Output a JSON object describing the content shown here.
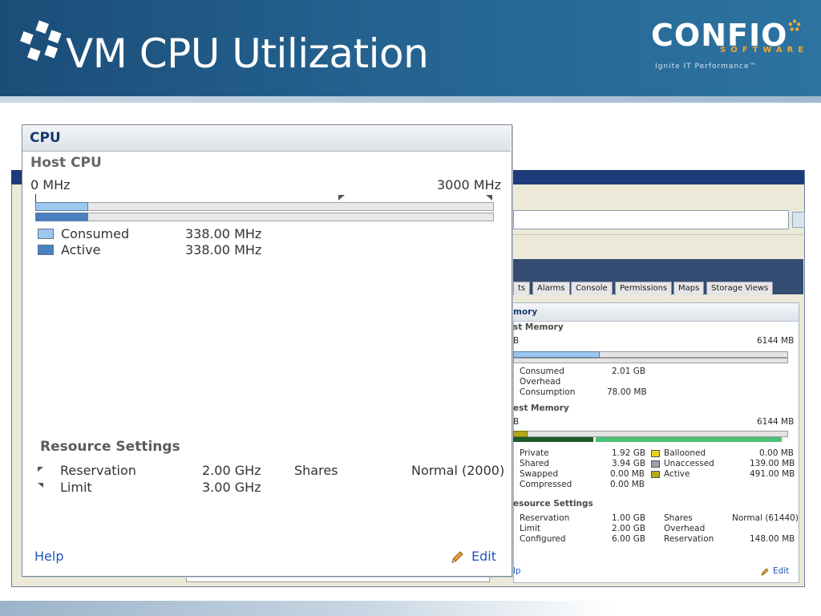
{
  "slide": {
    "title": "VM CPU Utilization",
    "logo_text": "CONFIO",
    "logo_sub": "SOFTWARE",
    "logo_tagline": "Ignite IT Performance™",
    "colors": {
      "header": "#1b4d78",
      "accent": "#f0a830"
    }
  },
  "cpu_panel": {
    "title": "CPU",
    "host_cpu": {
      "heading": "Host CPU",
      "scale_min": "0 MHz",
      "scale_max": "3000 MHz",
      "consumed_fraction": 0.113,
      "active_fraction": 0.113,
      "legend": [
        {
          "label": "Consumed",
          "value": "338.00 MHz",
          "color": "#9cc8ef"
        },
        {
          "label": "Active",
          "value": "338.00 MHz",
          "color": "#4a7fc0"
        }
      ]
    },
    "resource_settings": {
      "heading": "Resource Settings",
      "rows": [
        {
          "label": "Reservation",
          "value": "2.00 GHz"
        },
        {
          "label": "Limit",
          "value": "3.00 GHz"
        }
      ],
      "shares_label": "Shares",
      "shares_value": "Normal (2000)"
    },
    "help": "Help",
    "edit": "Edit"
  },
  "background_client": {
    "tabs": [
      "ts",
      "Alarms",
      "Console",
      "Permissions",
      "Maps",
      "Storage Views"
    ],
    "panel_title": "mory",
    "host_memory": {
      "heading": "st Memory",
      "scale_min": "B",
      "scale_max": "6144 MB",
      "rows": [
        {
          "label": "Consumed",
          "value": "2.01 GB"
        },
        {
          "label": "Overhead",
          "value": ""
        },
        {
          "label": "Consumption",
          "value": "78.00 MB"
        }
      ]
    },
    "guest_memory": {
      "heading": "est Memory",
      "scale_min": "B",
      "scale_max": "6144 MB",
      "left_rows": [
        {
          "label": "Private",
          "value": "1.92 GB"
        },
        {
          "label": "Shared",
          "value": "3.94 GB"
        },
        {
          "label": "Swapped",
          "value": "0.00 MB"
        },
        {
          "label": "Compressed",
          "value": "0.00 MB"
        }
      ],
      "right_rows": [
        {
          "label": "Ballooned",
          "value": "0.00 MB",
          "color": "#f2d01a"
        },
        {
          "label": "Unaccessed",
          "value": "139.00 MB",
          "color": "#a0a0a0"
        },
        {
          "label": "Active",
          "value": "491.00 MB",
          "color": "#b2a81a"
        }
      ]
    },
    "resource_settings": {
      "heading": "esource Settings",
      "rows": [
        {
          "label": "Reservation",
          "value": "1.00 GB",
          "label2": "Shares",
          "value2": "Normal (61440)"
        },
        {
          "label": "Limit",
          "value": "2.00 GB",
          "label2": "Overhead",
          "value2": ""
        },
        {
          "label": "Configured",
          "value": "6.00 GB",
          "label2": "Reservation",
          "value2": "148.00 MB"
        }
      ]
    },
    "help": "lp",
    "edit": "Edit"
  }
}
